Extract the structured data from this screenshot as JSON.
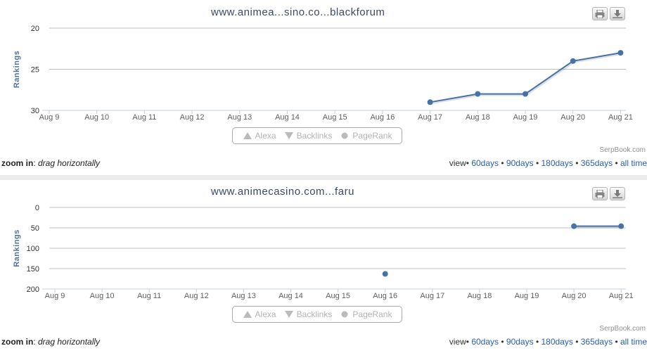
{
  "colors": {
    "series": "#4572a7",
    "grid": "#c0c0c0",
    "axis_text": "#606060",
    "ylabel": "#4d759e"
  },
  "chart_data": [
    {
      "type": "line",
      "title": "www.animea...sino.co...blackforum",
      "ylabel": "Rankings",
      "x": [
        "Aug 9",
        "Aug 10",
        "Aug 11",
        "Aug 12",
        "Aug 13",
        "Aug 14",
        "Aug 15",
        "Aug 16",
        "Aug 17",
        "Aug 18",
        "Aug 19",
        "Aug 20",
        "Aug 21"
      ],
      "y_ticks": [
        "20",
        "25",
        "30"
      ],
      "ylim": [
        30,
        20
      ],
      "y_reversed": true,
      "series": [
        {
          "values": [
            null,
            null,
            null,
            null,
            null,
            null,
            null,
            null,
            29,
            28,
            28,
            24,
            23
          ]
        }
      ],
      "legend": [
        "Alexa",
        "Backlinks",
        "PageRank"
      ],
      "grid": true
    },
    {
      "type": "line",
      "title": "www.animecasino.com...faru",
      "ylabel": "Rankings",
      "x": [
        "Aug 9",
        "Aug 10",
        "Aug 11",
        "Aug 12",
        "Aug 13",
        "Aug 14",
        "Aug 15",
        "Aug 16",
        "Aug 17",
        "Aug 18",
        "Aug 19",
        "Aug 20",
        "Aug 21"
      ],
      "y_ticks": [
        "0",
        "50",
        "100",
        "150",
        "200"
      ],
      "ylim": [
        200,
        0
      ],
      "y_reversed": true,
      "series": [
        {
          "values": [
            null,
            null,
            null,
            null,
            null,
            null,
            null,
            163,
            null,
            null,
            null,
            46,
            46
          ]
        }
      ],
      "legend": [
        "Alexa",
        "Backlinks",
        "PageRank"
      ],
      "grid": true
    }
  ],
  "credit": "SerpBook.com",
  "zoom": {
    "label": "zoom in",
    "hint": "drag horizontally"
  },
  "view": {
    "label": "view",
    "links": [
      "60days",
      "90days",
      "180days",
      "365days",
      "all time"
    ]
  },
  "icons": {
    "print": "print-icon",
    "download": "download-icon"
  }
}
